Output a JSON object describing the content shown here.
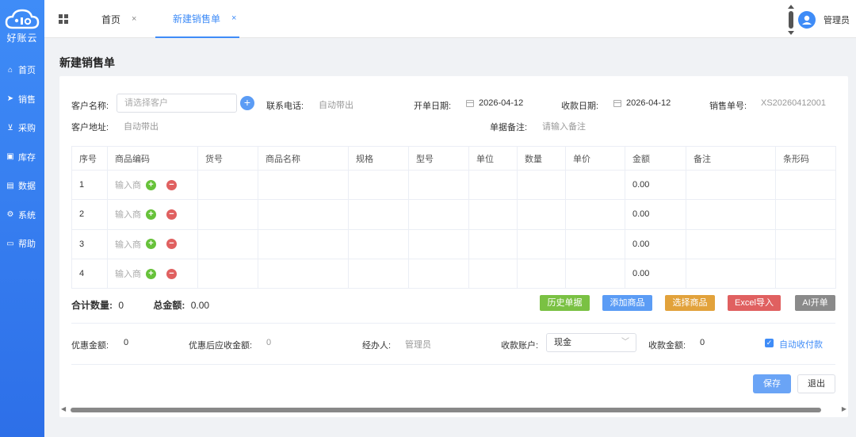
{
  "sidebar": {
    "logo_text": "好账云",
    "items": [
      {
        "label": "首页",
        "icon": "home-icon",
        "glyph": "⌂"
      },
      {
        "label": "销售",
        "icon": "send-icon",
        "glyph": "➤"
      },
      {
        "label": "采购",
        "icon": "cart-icon",
        "glyph": "🛒"
      },
      {
        "label": "库存",
        "icon": "box-icon",
        "glyph": "▣"
      },
      {
        "label": "数据",
        "icon": "chart-icon",
        "glyph": "▤"
      },
      {
        "label": "系统",
        "icon": "gear-icon",
        "glyph": "⚙"
      },
      {
        "label": "帮助",
        "icon": "help-icon",
        "glyph": "▭"
      }
    ]
  },
  "tabs": {
    "home": "首页",
    "active": "新建销售单",
    "close": "×"
  },
  "user": {
    "name": "管理员"
  },
  "page": {
    "title": "新建销售单"
  },
  "form": {
    "customer_name_label": "客户名称:",
    "customer_placeholder": "请选择客户",
    "phone_label": "联系电话:",
    "phone_value": "自动带出",
    "open_date_label": "开单日期:",
    "open_date_value": "2026-04-12",
    "pay_date_label": "收款日期:",
    "pay_date_value": "2026-04-12",
    "order_no_label": "销售单号:",
    "order_no_value": "XS20260412001",
    "address_label": "客户地址:",
    "address_value": "自动带出",
    "remark_label": "单据备注:",
    "remark_placeholder": "请输入备注"
  },
  "table": {
    "headers": [
      "序号",
      "商品编码",
      "货号",
      "商品名称",
      "规格",
      "型号",
      "单位",
      "数量",
      "单价",
      "金额",
      "备注",
      "条形码"
    ],
    "code_placeholder": "输入商",
    "rows": [
      {
        "no": "1",
        "amount": "0.00"
      },
      {
        "no": "2",
        "amount": "0.00"
      },
      {
        "no": "3",
        "amount": "0.00"
      },
      {
        "no": "4",
        "amount": "0.00"
      }
    ]
  },
  "totals": {
    "qty_label": "合计数量:",
    "qty_value": "0",
    "amount_label": "总金额:",
    "amount_value": "0.00"
  },
  "actions": {
    "history": "历史单据",
    "add_item": "添加商品",
    "select_item": "选择商品",
    "excel_import": "Excel导入",
    "ai_order": "AI开单"
  },
  "colors": {
    "history": "#7ac143",
    "add_item": "#5b9cf5",
    "select_item": "#e2a23b",
    "excel_import": "#e06060",
    "ai_order": "#8a8a8a"
  },
  "footer": {
    "discount_label": "优惠金额:",
    "discount_value": "0",
    "after_discount_label": "优惠后应收金额:",
    "after_discount_value": "0",
    "handler_label": "经办人:",
    "handler_value": "管理员",
    "account_label": "收款账户:",
    "account_value": "现金",
    "received_label": "收款金额:",
    "received_value": "0",
    "auto_pay_label": "自动收付款",
    "save": "保存",
    "exit": "退出"
  }
}
